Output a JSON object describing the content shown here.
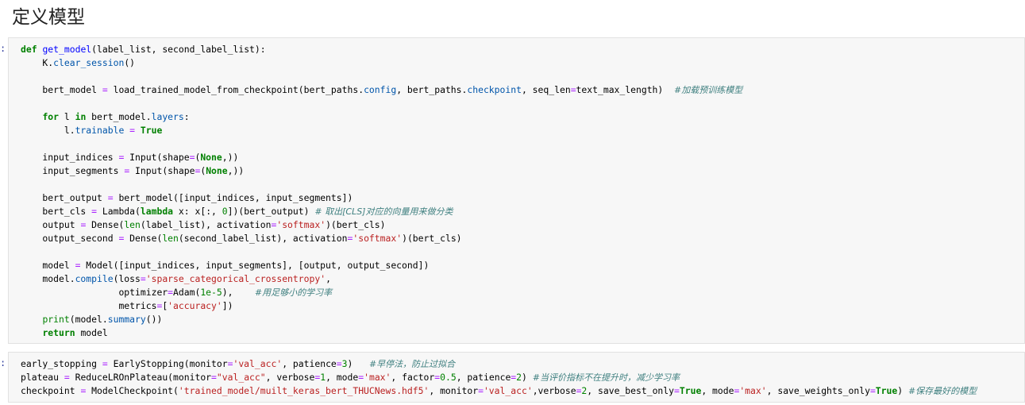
{
  "section_title": "定义模型",
  "cell1": {
    "prompt": ":",
    "lines": [
      [
        [
          "k",
          "def"
        ],
        [
          "t",
          " "
        ],
        [
          "f",
          "get_model"
        ],
        [
          "t",
          "(label_list, second_label_list):"
        ]
      ],
      [
        [
          "t",
          "    K."
        ],
        [
          "a",
          "clear_session"
        ],
        [
          "t",
          "()"
        ]
      ],
      [],
      [
        [
          "t",
          "    bert_model "
        ],
        [
          "o",
          "="
        ],
        [
          "t",
          " load_trained_model_from_checkpoint(bert_paths."
        ],
        [
          "a",
          "config"
        ],
        [
          "t",
          ", bert_paths."
        ],
        [
          "a",
          "checkpoint"
        ],
        [
          "t",
          ", seq_len"
        ],
        [
          "o",
          "="
        ],
        [
          "t",
          "text_max_length)  "
        ],
        [
          "c",
          "#加载预训练模型"
        ]
      ],
      [],
      [
        [
          "t",
          "    "
        ],
        [
          "k",
          "for"
        ],
        [
          "t",
          " l "
        ],
        [
          "k",
          "in"
        ],
        [
          "t",
          " bert_model."
        ],
        [
          "a",
          "layers"
        ],
        [
          "t",
          ":"
        ]
      ],
      [
        [
          "t",
          "        l."
        ],
        [
          "a",
          "trainable"
        ],
        [
          "t",
          " "
        ],
        [
          "o",
          "="
        ],
        [
          "t",
          " "
        ],
        [
          "k",
          "True"
        ]
      ],
      [],
      [
        [
          "t",
          "    input_indices "
        ],
        [
          "o",
          "="
        ],
        [
          "t",
          " Input(shape"
        ],
        [
          "o",
          "="
        ],
        [
          "t",
          "("
        ],
        [
          "k",
          "None"
        ],
        [
          "t",
          ",))"
        ]
      ],
      [
        [
          "t",
          "    input_segments "
        ],
        [
          "o",
          "="
        ],
        [
          "t",
          " Input(shape"
        ],
        [
          "o",
          "="
        ],
        [
          "t",
          "("
        ],
        [
          "k",
          "None"
        ],
        [
          "t",
          ",))"
        ]
      ],
      [],
      [
        [
          "t",
          "    bert_output "
        ],
        [
          "o",
          "="
        ],
        [
          "t",
          " bert_model([input_indices, input_segments])"
        ]
      ],
      [
        [
          "t",
          "    bert_cls "
        ],
        [
          "o",
          "="
        ],
        [
          "t",
          " Lambda("
        ],
        [
          "k",
          "lambda"
        ],
        [
          "t",
          " x: x[:, "
        ],
        [
          "n",
          "0"
        ],
        [
          "t",
          "])(bert_output) "
        ],
        [
          "c",
          "# 取出[CLS]对应的向量用来做分类"
        ]
      ],
      [
        [
          "t",
          "    output "
        ],
        [
          "o",
          "="
        ],
        [
          "t",
          " Dense("
        ],
        [
          "n",
          "len"
        ],
        [
          "t",
          "(label_list), activation"
        ],
        [
          "o",
          "="
        ],
        [
          "s",
          "'softmax'"
        ],
        [
          "t",
          ")(bert_cls)"
        ]
      ],
      [
        [
          "t",
          "    output_second "
        ],
        [
          "o",
          "="
        ],
        [
          "t",
          " Dense("
        ],
        [
          "n",
          "len"
        ],
        [
          "t",
          "(second_label_list), activation"
        ],
        [
          "o",
          "="
        ],
        [
          "s",
          "'softmax'"
        ],
        [
          "t",
          ")(bert_cls)"
        ]
      ],
      [],
      [
        [
          "t",
          "    model "
        ],
        [
          "o",
          "="
        ],
        [
          "t",
          " Model([input_indices, input_segments], [output, output_second])"
        ]
      ],
      [
        [
          "t",
          "    model."
        ],
        [
          "a",
          "compile"
        ],
        [
          "t",
          "(loss"
        ],
        [
          "o",
          "="
        ],
        [
          "s",
          "'sparse_categorical_crossentropy'"
        ],
        [
          "t",
          ","
        ]
      ],
      [
        [
          "t",
          "                  optimizer"
        ],
        [
          "o",
          "="
        ],
        [
          "t",
          "Adam("
        ],
        [
          "n",
          "1e-5"
        ],
        [
          "t",
          "),    "
        ],
        [
          "c",
          "#用足够小的学习率"
        ]
      ],
      [
        [
          "t",
          "                  metrics"
        ],
        [
          "o",
          "="
        ],
        [
          "t",
          "["
        ],
        [
          "s",
          "'accuracy'"
        ],
        [
          "t",
          "])"
        ]
      ],
      [
        [
          "t",
          "    "
        ],
        [
          "n",
          "print"
        ],
        [
          "t",
          "(model."
        ],
        [
          "a",
          "summary"
        ],
        [
          "t",
          "())"
        ]
      ],
      [
        [
          "t",
          "    "
        ],
        [
          "k",
          "return"
        ],
        [
          "t",
          " model"
        ]
      ]
    ]
  },
  "cell2": {
    "prompt": ":",
    "lines": [
      [
        [
          "t",
          "early_stopping "
        ],
        [
          "o",
          "="
        ],
        [
          "t",
          " EarlyStopping(monitor"
        ],
        [
          "o",
          "="
        ],
        [
          "s",
          "'val_acc'"
        ],
        [
          "t",
          ", patience"
        ],
        [
          "o",
          "="
        ],
        [
          "n",
          "3"
        ],
        [
          "t",
          ")   "
        ],
        [
          "c",
          "#早停法，防止过拟合"
        ]
      ],
      [
        [
          "t",
          "plateau "
        ],
        [
          "o",
          "="
        ],
        [
          "t",
          " ReduceLROnPlateau(monitor"
        ],
        [
          "o",
          "="
        ],
        [
          "s",
          "\"val_acc\""
        ],
        [
          "t",
          ", verbose"
        ],
        [
          "o",
          "="
        ],
        [
          "n",
          "1"
        ],
        [
          "t",
          ", mode"
        ],
        [
          "o",
          "="
        ],
        [
          "s",
          "'max'"
        ],
        [
          "t",
          ", factor"
        ],
        [
          "o",
          "="
        ],
        [
          "n",
          "0.5"
        ],
        [
          "t",
          ", patience"
        ],
        [
          "o",
          "="
        ],
        [
          "n",
          "2"
        ],
        [
          "t",
          ") "
        ],
        [
          "c",
          "#当评价指标不在提升时，减少学习率"
        ]
      ],
      [
        [
          "t",
          "checkpoint "
        ],
        [
          "o",
          "="
        ],
        [
          "t",
          " ModelCheckpoint("
        ],
        [
          "s",
          "'trained_model/muilt_keras_bert_THUCNews.hdf5'"
        ],
        [
          "t",
          ", monitor"
        ],
        [
          "o",
          "="
        ],
        [
          "s",
          "'val_acc'"
        ],
        [
          "t",
          ",verbose"
        ],
        [
          "o",
          "="
        ],
        [
          "n",
          "2"
        ],
        [
          "t",
          ", save_best_only"
        ],
        [
          "o",
          "="
        ],
        [
          "k",
          "True"
        ],
        [
          "t",
          ", mode"
        ],
        [
          "o",
          "="
        ],
        [
          "s",
          "'max'"
        ],
        [
          "t",
          ", save_weights_only"
        ],
        [
          "o",
          "="
        ],
        [
          "k",
          "True"
        ],
        [
          "t",
          ") "
        ],
        [
          "c",
          "#保存最好的模型"
        ]
      ]
    ]
  }
}
